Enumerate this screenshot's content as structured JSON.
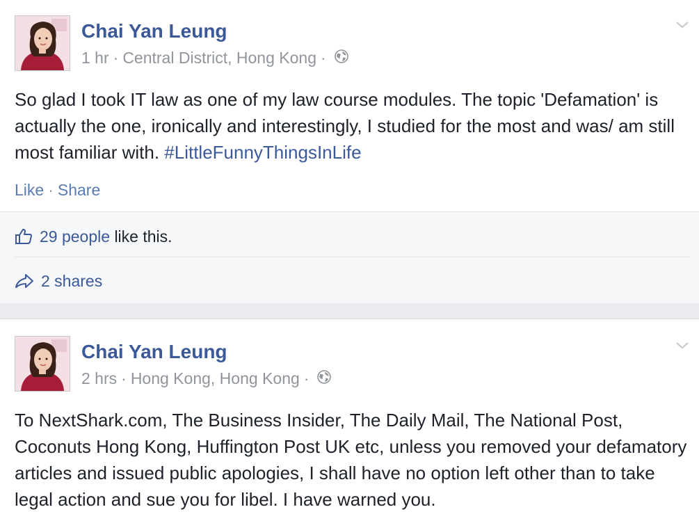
{
  "posts": [
    {
      "author": "Chai Yan Leung",
      "time": "1 hr",
      "location": "Central District, Hong Kong",
      "privacy_icon": "globe-icon",
      "text": "So glad I took IT law as one of my law course modules. The topic 'Defamation' is actually the one, ironically and interestingly, I studied for the most and was/ am still most familiar with.",
      "hashtag": "#LittleFunnyThingsInLife",
      "actions": {
        "like": "Like",
        "share": "Share"
      },
      "likes": {
        "count": "29 people",
        "suffix": "like this."
      },
      "shares": "2 shares"
    },
    {
      "author": "Chai Yan Leung",
      "time": "2 hrs",
      "location": "Hong Kong, Hong Kong",
      "privacy_icon": "globe-icon",
      "text": "To NextShark.com, The Business Insider, The Daily Mail, The National Post, Coconuts Hong Kong, Huffington Post UK etc, unless you removed your defamatory articles and issued public apologies, I shall have no option left other than to take legal action and sue you for libel. I have warned you."
    }
  ],
  "colors": {
    "link": "#3b5998",
    "meta": "#90949c",
    "text": "#1d2129",
    "page_bg": "#e9ebee",
    "card_bg": "#ffffff",
    "stats_bg": "#f6f7f9"
  },
  "separator": "·"
}
